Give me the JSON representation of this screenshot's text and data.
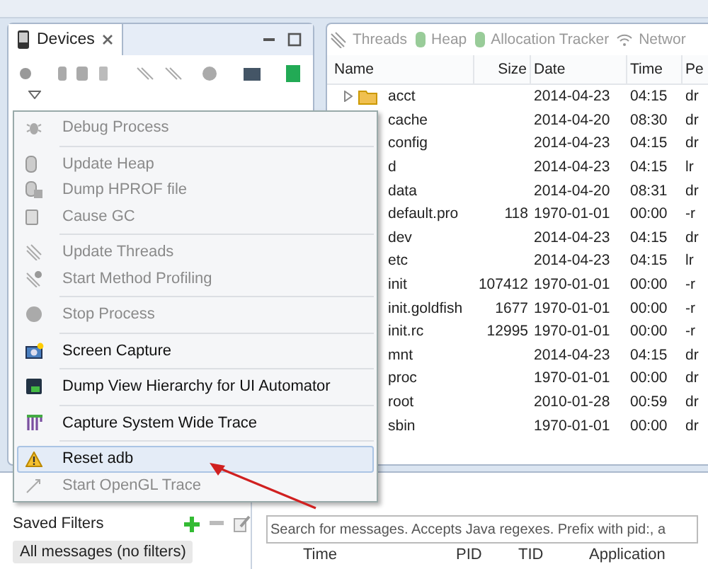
{
  "devices_panel": {
    "title": "Devices"
  },
  "menu": [
    {
      "label": "Debug Process",
      "kind": "bug",
      "disabled": true,
      "selected": false
    },
    {
      "kind": "separator"
    },
    {
      "label": "Update Heap",
      "kind": "heap",
      "disabled": true,
      "selected": false
    },
    {
      "label": "Dump HPROF file",
      "kind": "dump",
      "disabled": true,
      "selected": false
    },
    {
      "label": "Cause GC",
      "kind": "gc",
      "disabled": true,
      "selected": false
    },
    {
      "kind": "separator"
    },
    {
      "label": "Update Threads",
      "kind": "threads",
      "disabled": true,
      "selected": false
    },
    {
      "label": "Start Method Profiling",
      "kind": "profile",
      "disabled": true,
      "selected": false
    },
    {
      "kind": "separator"
    },
    {
      "label": "Stop Process",
      "kind": "stop",
      "disabled": true,
      "selected": false
    },
    {
      "kind": "separator"
    },
    {
      "label": "Screen Capture",
      "kind": "camera",
      "disabled": false,
      "selected": false
    },
    {
      "kind": "separator"
    },
    {
      "label": "Dump View Hierarchy for UI Automator",
      "kind": "hierarchy",
      "disabled": false,
      "selected": false
    },
    {
      "kind": "separator"
    },
    {
      "label": "Capture System Wide Trace",
      "kind": "trace",
      "disabled": false,
      "selected": false
    },
    {
      "kind": "separator"
    },
    {
      "label": "Reset adb",
      "kind": "warning",
      "disabled": false,
      "selected": true
    },
    {
      "label": "Start OpenGL Trace",
      "kind": "opengl",
      "disabled": true,
      "selected": false
    }
  ],
  "tabs": [
    {
      "label": "Threads",
      "kind": "threads"
    },
    {
      "label": "Heap",
      "kind": "heap"
    },
    {
      "label": "Allocation Tracker",
      "kind": "heap"
    },
    {
      "label": "Networ",
      "kind": "wifi"
    }
  ],
  "file_table": {
    "columns": [
      "Name",
      "Size",
      "Date",
      "Time",
      "Pe"
    ],
    "rows": [
      {
        "name": "acct",
        "size": "",
        "date": "2014-04-23",
        "time": "04:15",
        "perm": "dr",
        "kind": "folder"
      },
      {
        "name": "cache",
        "size": "",
        "date": "2014-04-20",
        "time": "08:30",
        "perm": "dr"
      },
      {
        "name": "config",
        "size": "",
        "date": "2014-04-23",
        "time": "04:15",
        "perm": "dr"
      },
      {
        "name": "d",
        "size": "",
        "date": "2014-04-23",
        "time": "04:15",
        "perm": "lr"
      },
      {
        "name": "data",
        "size": "",
        "date": "2014-04-20",
        "time": "08:31",
        "perm": "dr"
      },
      {
        "name": "default.pro",
        "size": "118",
        "date": "1970-01-01",
        "time": "00:00",
        "perm": "-r"
      },
      {
        "name": "dev",
        "size": "",
        "date": "2014-04-23",
        "time": "04:15",
        "perm": "dr"
      },
      {
        "name": "etc",
        "size": "",
        "date": "2014-04-23",
        "time": "04:15",
        "perm": "lr"
      },
      {
        "name": "init",
        "size": "107412",
        "date": "1970-01-01",
        "time": "00:00",
        "perm": "-r"
      },
      {
        "name": "init.goldfish",
        "size": "1677",
        "date": "1970-01-01",
        "time": "00:00",
        "perm": "-r"
      },
      {
        "name": "init.rc",
        "size": "12995",
        "date": "1970-01-01",
        "time": "00:00",
        "perm": "-r"
      },
      {
        "name": "mnt",
        "size": "",
        "date": "2014-04-23",
        "time": "04:15",
        "perm": "dr"
      },
      {
        "name": "proc",
        "size": "",
        "date": "1970-01-01",
        "time": "00:00",
        "perm": "dr"
      },
      {
        "name": "root",
        "size": "",
        "date": "2010-01-28",
        "time": "00:59",
        "perm": "dr"
      },
      {
        "name": "sbin",
        "size": "",
        "date": "1970-01-01",
        "time": "00:00",
        "perm": "dr"
      }
    ]
  },
  "saved_filters": {
    "title": "Saved Filters",
    "items": [
      "All messages (no filters)"
    ]
  },
  "log": {
    "search": {
      "placeholder": "Search for messages. Accepts Java regexes. Prefix with pid:, a"
    },
    "columns": [
      "Time",
      "PID",
      "TID",
      "Application"
    ]
  }
}
